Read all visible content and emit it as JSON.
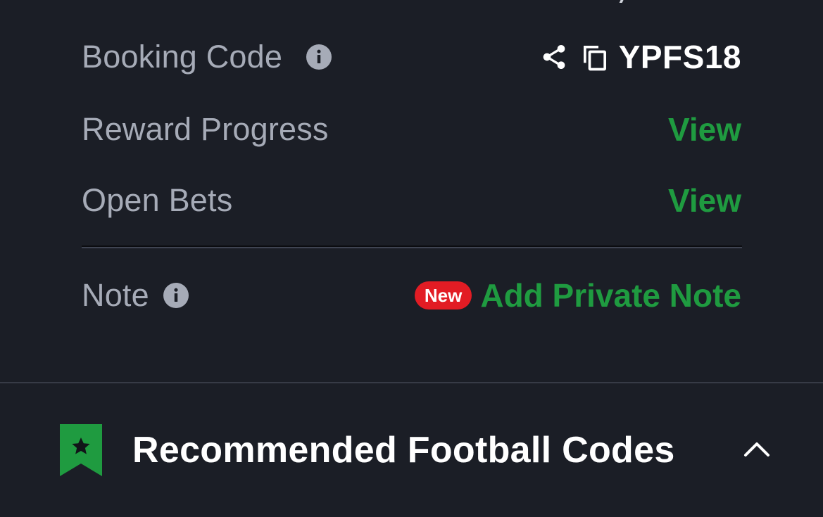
{
  "booking": {
    "label": "Booking Code",
    "code": "YPFS18"
  },
  "reward": {
    "label": "Reward Progress",
    "action": "View"
  },
  "open_bets": {
    "label": "Open Bets",
    "action": "View"
  },
  "note": {
    "label": "Note",
    "badge": "New",
    "action": "Add Private Note"
  },
  "recommended": {
    "title": "Recommended Football Codes"
  },
  "colors": {
    "background": "#1b1e26",
    "label": "#a6abb7",
    "accent_green": "#1f9b40",
    "badge_red": "#e21c24",
    "text_white": "#ffffff"
  },
  "icons": {
    "booking_info": "info-icon",
    "share": "share-icon",
    "copy": "copy-icon",
    "note_info": "info-icon",
    "bookmark": "bookmark-star-icon",
    "collapse": "chevron-up-icon"
  }
}
